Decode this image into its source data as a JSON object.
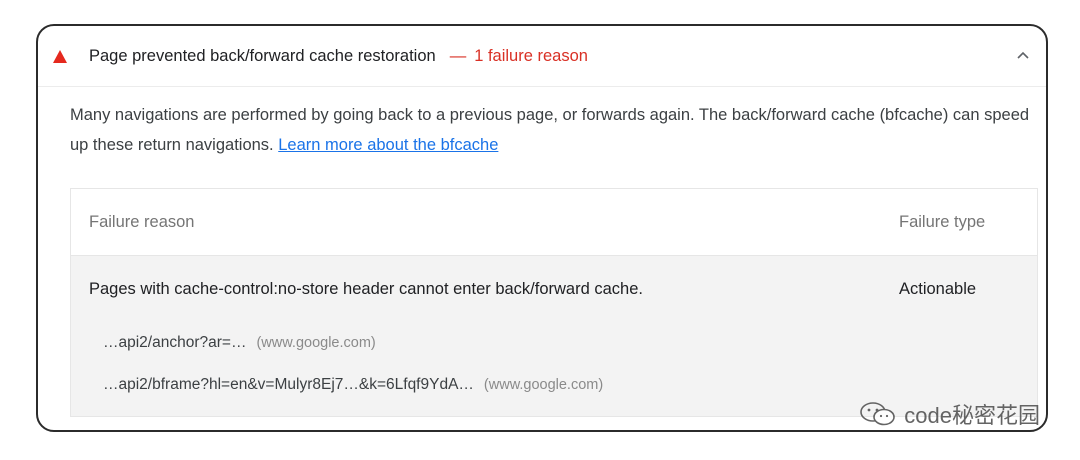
{
  "audit": {
    "title": "Page prevented back/forward cache restoration",
    "separator": "—",
    "failure_count": "1 failure reason",
    "description_text": "Many navigations are performed by going back to a previous page, or forwards again. The back/forward cache (bfcache) can speed up these return navigations.",
    "learn_more_link": "Learn more about the bfcache",
    "colors": {
      "warning": "#e5291e",
      "link": "#1a73e8"
    }
  },
  "table": {
    "headers": {
      "reason": "Failure reason",
      "type": "Failure type"
    },
    "rows": [
      {
        "reason": "Pages with cache-control:no-store header cannot enter back/forward cache.",
        "type": "Actionable",
        "subitems": [
          {
            "url": "…api2/anchor?ar=…",
            "origin": "(www.google.com)"
          },
          {
            "url": "…api2/bframe?hl=en&v=Mulyr8Ej7…&k=6Lfqf9YdA…",
            "origin": "(www.google.com)"
          }
        ]
      }
    ]
  },
  "watermark": {
    "text": "code秘密花园",
    "icon": "wechat-icon"
  }
}
